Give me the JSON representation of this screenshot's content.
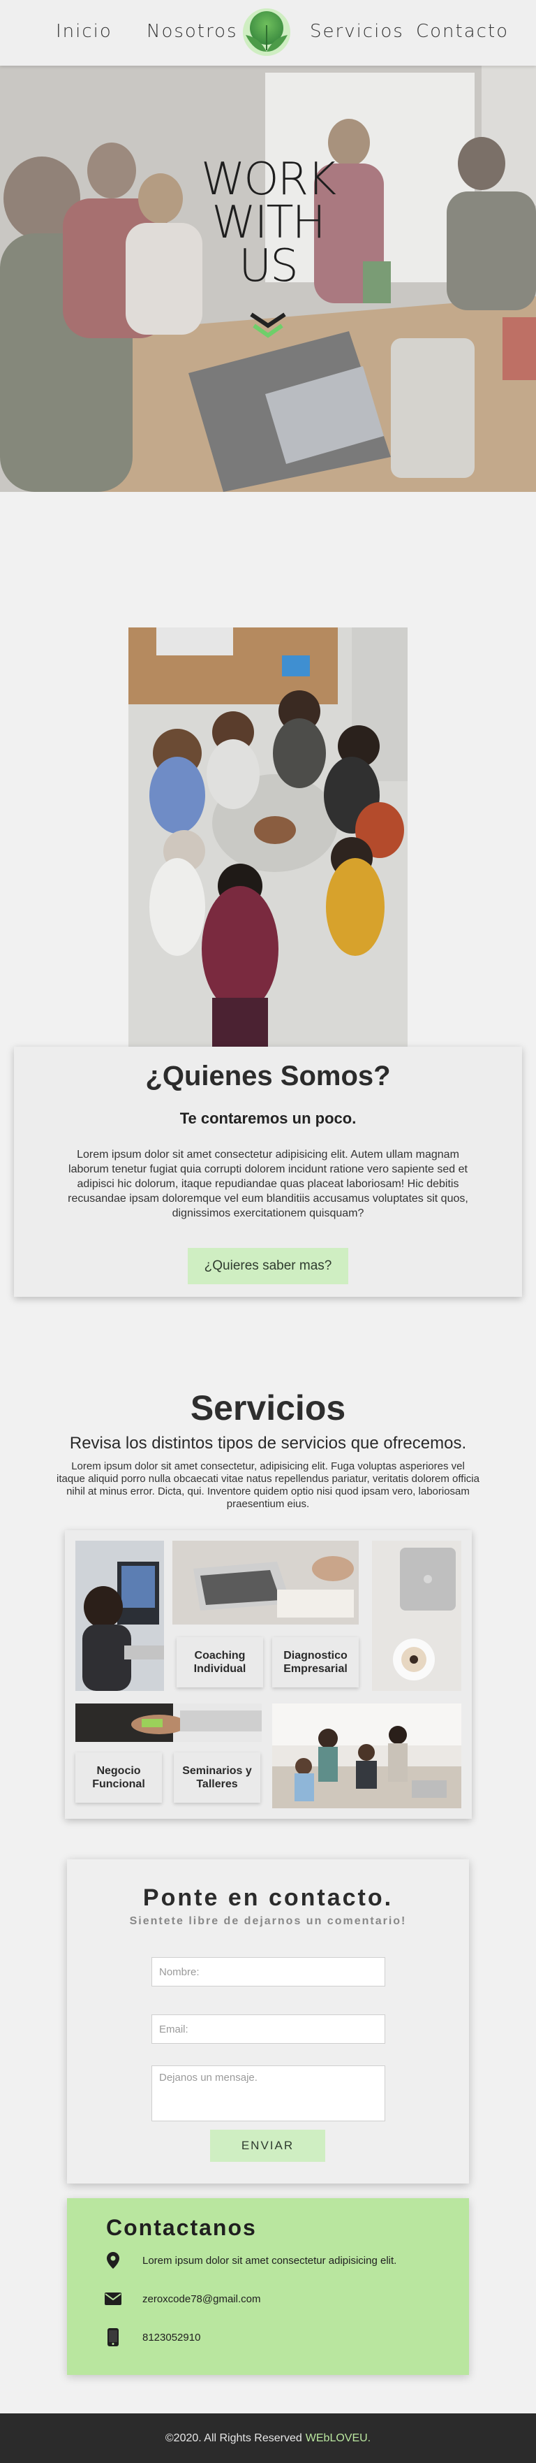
{
  "nav": {
    "items": [
      {
        "label": "Inicio"
      },
      {
        "label": "Nosotros"
      },
      {
        "label": "Servicios"
      },
      {
        "label": "Contacto"
      }
    ],
    "logo_icon": "leaf-logo-icon"
  },
  "hero": {
    "title_lines": [
      "WORK",
      "WITH",
      "US"
    ],
    "arrow_icon": "chevron-down-icon"
  },
  "about": {
    "title": "¿Quienes Somos?",
    "subtitle": "Te contaremos un poco.",
    "text": "Lorem ipsum dolor sit amet consectetur adipisicing elit. Autem ullam magnam laborum tenetur fugiat quia corrupti dolorem incidunt ratione vero sapiente sed et adipisci hic dolorum, itaque repudiandae quas placeat laboriosam! Hic debitis recusandae ipsam doloremque vel eum blanditiis accusamus voluptates sit quos, dignissimos exercitationem quisquam?",
    "button_label": "¿Quieres saber mas?"
  },
  "services": {
    "title": "Servicios",
    "subtitle": "Revisa los distintos tipos de servicios que ofrecemos.",
    "text": "Lorem ipsum dolor sit amet consectetur, adipisicing elit. Fuga voluptas asperiores vel itaque aliquid porro nulla obcaecati vitae natus repellendus pariatur, veritatis dolorem officia nihil at minus error. Dicta, qui. Inventore quidem optio nisi quod ipsam vero, laboriosam praesentium eius.",
    "items": [
      {
        "label": "Coaching Individual"
      },
      {
        "label": "Diagnostico Empresarial"
      },
      {
        "label": "Negocio Funcional"
      },
      {
        "label": "Seminarios y Talleres"
      }
    ]
  },
  "contact_form": {
    "title": "Ponte en contacto.",
    "subtitle": "Sientete libre de dejarnos un comentario!",
    "name_placeholder": "Nombre:",
    "email_placeholder": "Email:",
    "message_placeholder": "Dejanos un mensaje.",
    "submit_label": "ENVIAR"
  },
  "contact_info": {
    "title": "Contactanos",
    "address": "Lorem ipsum dolor sit amet consectetur adipisicing elit.",
    "email": "zeroxcode78@gmail.com",
    "phone": "8123052910",
    "icons": [
      "map-pin-icon",
      "envelope-icon",
      "phone-icon"
    ]
  },
  "footer": {
    "text": "©2020. All Rights Reserved",
    "brand": "WEbLOVEU."
  },
  "colors": {
    "accent": "#b9e69f",
    "button": "#cfeec2",
    "background": "#f1f1f1",
    "footer": "#2b2b2b"
  }
}
